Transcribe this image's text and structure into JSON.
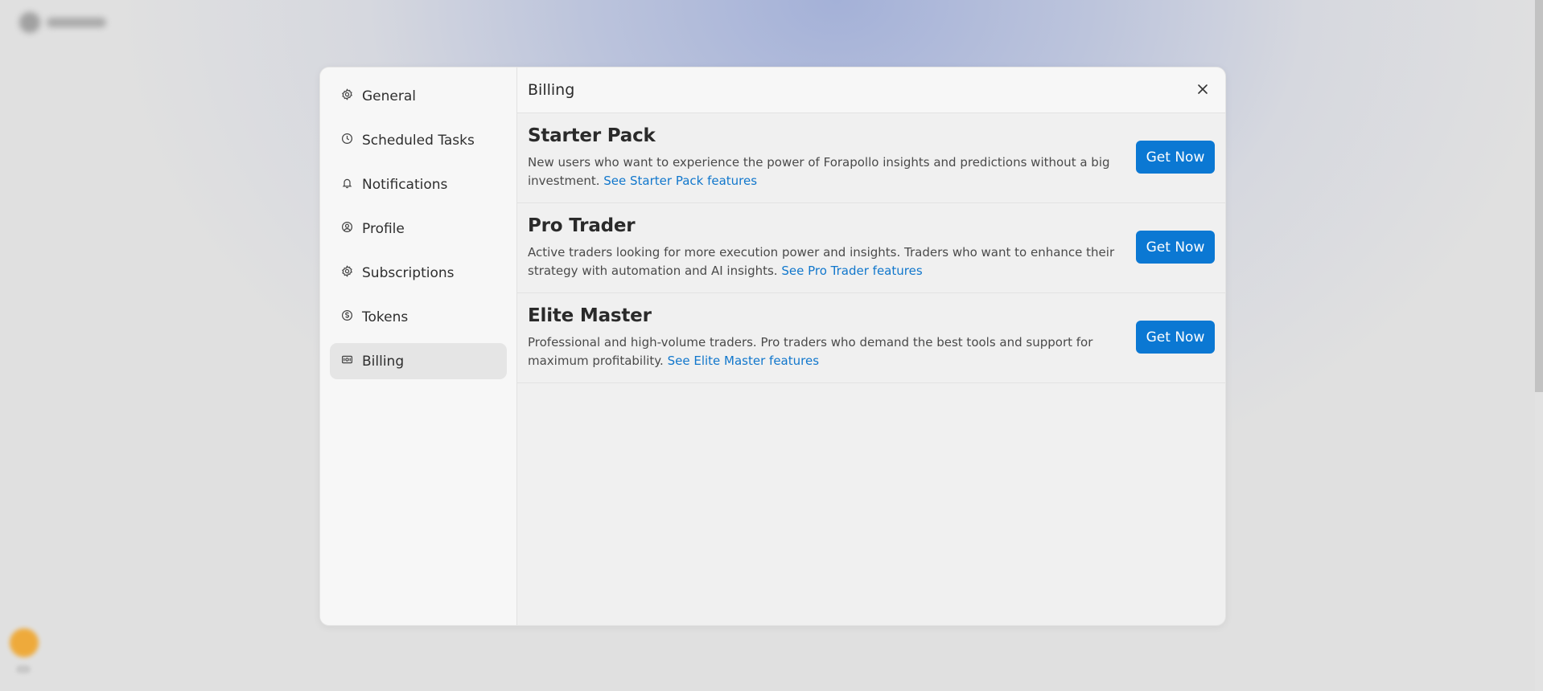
{
  "colors": {
    "accent": "#0b78d3",
    "link": "#1177cc",
    "active_nav_bg": "#e5e5e5"
  },
  "sidebar": {
    "items": [
      {
        "label": "General",
        "icon": "gear-icon"
      },
      {
        "label": "Scheduled Tasks",
        "icon": "clock-icon"
      },
      {
        "label": "Notifications",
        "icon": "bell-icon"
      },
      {
        "label": "Profile",
        "icon": "user-circle-icon"
      },
      {
        "label": "Subscriptions",
        "icon": "gear-icon"
      },
      {
        "label": "Tokens",
        "icon": "coin-icon"
      },
      {
        "label": "Billing",
        "icon": "card-icon",
        "active": true
      }
    ]
  },
  "main": {
    "title": "Billing",
    "close_icon": "close-icon",
    "plans": [
      {
        "name": "Starter Pack",
        "description": "New users who want to experience the power of Forapollo insights and predictions without a big investment.",
        "link": "See Starter Pack features",
        "button": "Get Now"
      },
      {
        "name": "Pro Trader",
        "description": "Active traders looking for more execution power and insights. Traders who want to enhance their strategy with automation and AI insights.",
        "link": "See Pro Trader features",
        "button": "Get Now"
      },
      {
        "name": "Elite Master",
        "description": "Professional and high-volume traders. Pro traders who demand the best tools and support for maximum profitability.",
        "link": "See Elite Master features",
        "button": "Get Now"
      }
    ]
  }
}
